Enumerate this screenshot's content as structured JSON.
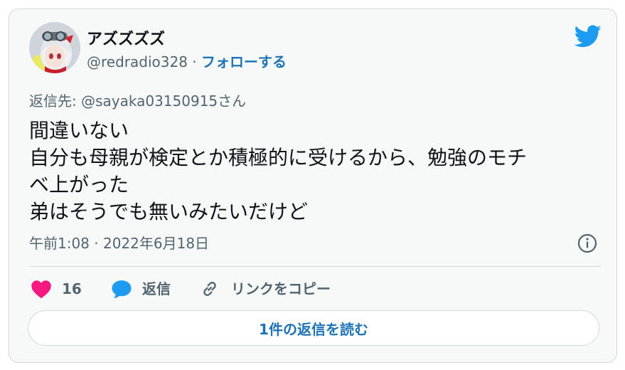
{
  "author": {
    "display_name": "アズズズズ",
    "handle": "@redradio328",
    "separator": "·",
    "follow_label": "フォローする",
    "avatar_icon": "anime-avatar-icon"
  },
  "reply_to": "返信先: @sayaka03150915さん",
  "tweet": {
    "lines": [
      "間違いない",
      "自分も母親が検定とか積極的に受けるから、勉強のモチ",
      "ベ上がった",
      "弟はそうでも無いみたいだけど"
    ],
    "timestamp": "午前1:08 · 2022年6月18日"
  },
  "actions": {
    "like_count": "16",
    "reply_label": "返信",
    "copy_link_label": "リンクをコピー"
  },
  "read_replies_label": "1件の返信を読む",
  "icons": {
    "brand": "twitter-bird-icon",
    "info": "info-icon",
    "like": "heart-icon",
    "reply": "speech-bubble-icon",
    "link": "link-icon"
  },
  "colors": {
    "brand_blue": "#1d9bf0",
    "link_blue": "#1d73b5",
    "like_pink": "#f91880",
    "text_primary": "#0f1419",
    "text_secondary": "#536471",
    "card_background": "#f7f9f9",
    "border": "#cfd9de"
  }
}
